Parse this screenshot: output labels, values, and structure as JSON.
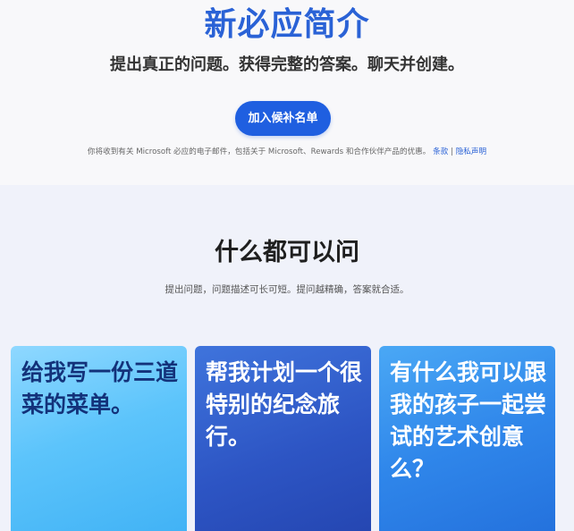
{
  "hero": {
    "title": "新必应简介",
    "subtitle": "提出真正的问题。获得完整的答案。聊天并创建。",
    "waitlist_button": "加入候补名单",
    "disclaimer_text": "你将收到有关 Microsoft 必应的电子邮件，包括关于 Microsoft、Rewards 和合作伙伴产品的优惠。",
    "terms_link": "条款",
    "separator": "|",
    "privacy_link": "隐私声明"
  },
  "section": {
    "title": "什么都可以问",
    "subtitle": "提出问题，问题描述可长可短。提问越精确，答案就合适。",
    "cards": [
      {
        "text": "给我写一份三道菜的菜单。"
      },
      {
        "text": "帮我计划一个很特别的纪念旅行。"
      },
      {
        "text": "有什么我可以跟我的孩子一起尝试的艺术创意么？"
      }
    ]
  },
  "colors": {
    "title_blue": "#2a62d6",
    "button_blue": "#1f5fe0",
    "card1_text": "#13327a",
    "card2_bg": "#2d55c4",
    "card3_bg": "#2f86ea"
  }
}
